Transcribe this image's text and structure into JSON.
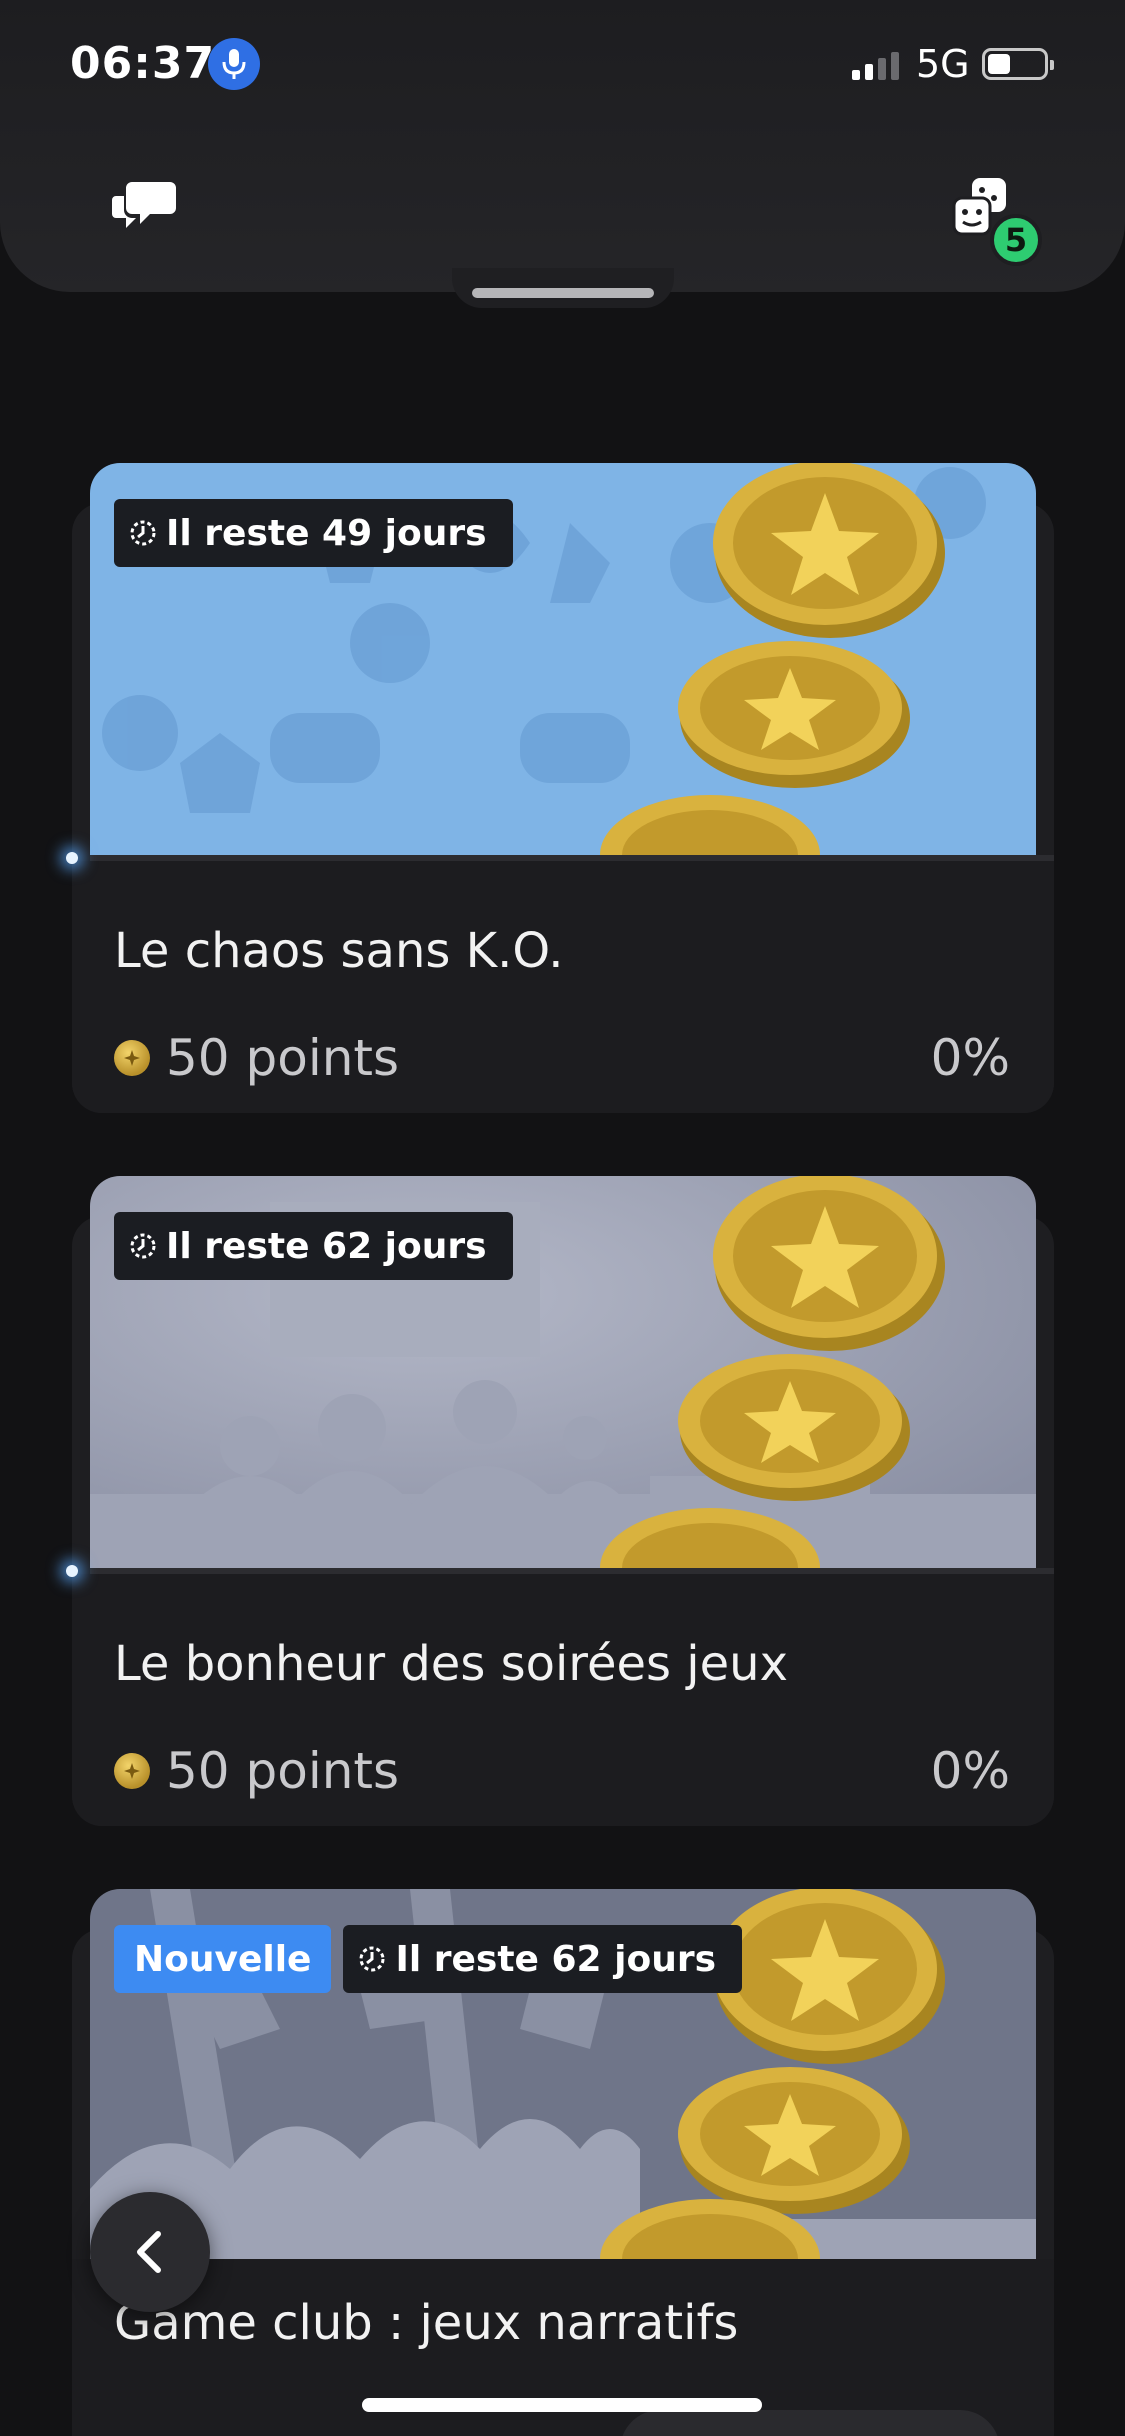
{
  "status_bar": {
    "time": "06:37",
    "network": "5G",
    "battery_level": 0.4,
    "signal_bars_active": 2
  },
  "header": {
    "left_icon": "chat-bubbles-icon",
    "right_icon": "game-lists-icon",
    "badge_count": "5"
  },
  "colors": {
    "background": "#121214",
    "card": "#1c1c1f",
    "new_badge": "#3d8bf2",
    "count_badge": "#2ecc71",
    "coin_gold": "#d4ac3a"
  },
  "challenges": [
    {
      "new_label": "",
      "time_left": "Il reste 49 jours",
      "title": "Le chaos sans K.O.",
      "points": "50 points",
      "progress": "0%",
      "banner_theme": "light-blue-pattern"
    },
    {
      "new_label": "",
      "time_left": "Il reste 62 jours",
      "title": "Le bonheur des soirées jeux",
      "points": "50 points",
      "progress": "0%",
      "banner_theme": "grey-audience"
    },
    {
      "new_label": "Nouvelle",
      "time_left": "Il reste 62 jours",
      "title": "Game club : jeux narratifs",
      "points": "",
      "progress": "",
      "banner_theme": "slate-books"
    }
  ],
  "nav": {
    "back_icon": "chevron-left-icon"
  }
}
